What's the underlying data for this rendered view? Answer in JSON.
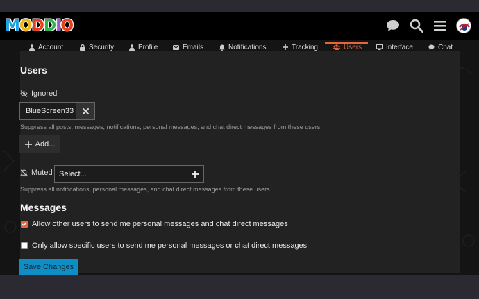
{
  "header": {
    "logo_text": "MODD.IO",
    "icons": [
      "chat-bubble-icon",
      "search-icon",
      "hamburger-menu-icon",
      "avatar"
    ]
  },
  "tabs": [
    {
      "label": "Account",
      "icon": "user-icon"
    },
    {
      "label": "Security",
      "icon": "lock-icon"
    },
    {
      "label": "Profile",
      "icon": "user-icon"
    },
    {
      "label": "Emails",
      "icon": "envelope-icon"
    },
    {
      "label": "Notifications",
      "icon": "bell-icon"
    },
    {
      "label": "Tracking",
      "icon": "plus-icon"
    },
    {
      "label": "Users",
      "icon": "users-icon",
      "active": true
    },
    {
      "label": "Interface",
      "icon": "monitor-icon"
    },
    {
      "label": "Chat",
      "icon": "chat-bubble-icon"
    }
  ],
  "users_section": {
    "title": "Users",
    "ignored": {
      "label": "Ignored",
      "chip": "BlueScreen33",
      "help": "Suppress all posts, messages, notifications, personal messages, and chat direct messages from these users.",
      "add_label": "Add..."
    },
    "muted": {
      "label": "Muted",
      "select_placeholder": "Select...",
      "help": "Suppress all notifications, personal messages, and chat direct messages from these users."
    }
  },
  "messages_section": {
    "title": "Messages",
    "options": [
      {
        "label": "Allow other users to send me personal messages and chat direct messages",
        "checked": true
      },
      {
        "label": "Only allow specific users to send me personal messages or chat direct messages",
        "checked": false
      }
    ]
  },
  "save_label": "Save Changes",
  "colors": {
    "accent": "#e8643b",
    "primary_button": "#0e8ec4",
    "header_bg": "#000000",
    "page_bg": "#141414"
  }
}
